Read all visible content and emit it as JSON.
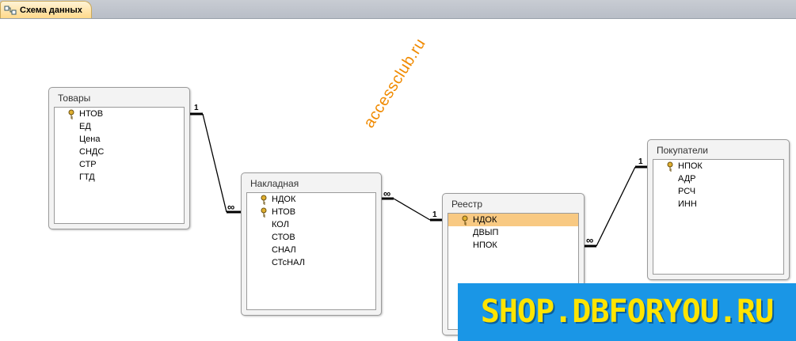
{
  "tab": {
    "label": "Схема данных",
    "icon": "relationships-icon"
  },
  "tables": [
    {
      "title": "Товары",
      "fields": [
        {
          "name": "НТОВ",
          "key": true
        },
        {
          "name": "ЕД"
        },
        {
          "name": "Цена"
        },
        {
          "name": "СНДС"
        },
        {
          "name": "СТР"
        },
        {
          "name": "ГТД"
        }
      ]
    },
    {
      "title": "Накладная",
      "fields": [
        {
          "name": "НДОК",
          "key": true
        },
        {
          "name": "НТОВ",
          "key": true
        },
        {
          "name": "КОЛ"
        },
        {
          "name": "СТОВ"
        },
        {
          "name": "СНАЛ"
        },
        {
          "name": "СТсНАЛ"
        }
      ]
    },
    {
      "title": "Реестр",
      "fields": [
        {
          "name": "НДОК",
          "key": true,
          "selected": true
        },
        {
          "name": "ДВЫП"
        },
        {
          "name": "НПОК"
        }
      ]
    },
    {
      "title": "Покупатели",
      "fields": [
        {
          "name": "НПОК",
          "key": true
        },
        {
          "name": "АДР"
        },
        {
          "name": "РСЧ"
        },
        {
          "name": "ИНН"
        }
      ]
    }
  ],
  "relationships": [
    {
      "one": "1",
      "many": "∞"
    },
    {
      "one": "1",
      "many": "∞"
    },
    {
      "one": "1",
      "many": "∞"
    }
  ],
  "watermark": "accessclub.ru",
  "banner": "SHOP.DBFORYOU.RU",
  "colors": {
    "selection": "#f8c982",
    "banner_bg": "#1a96e6",
    "banner_text": "#ffe400",
    "watermark": "#f08a00"
  }
}
